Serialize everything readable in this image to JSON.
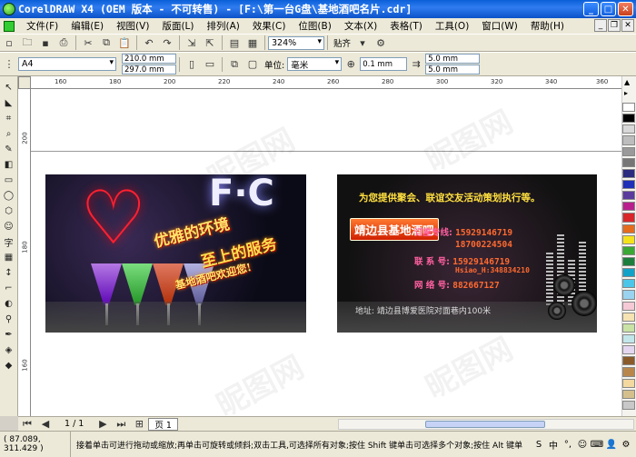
{
  "window": {
    "title": "CorelDRAW X4 (OEM 版本 - 不可转售) - [F:\\第一台G盘\\基地酒吧名片.cdr]"
  },
  "menu": [
    "文件(F)",
    "编辑(E)",
    "视图(V)",
    "版面(L)",
    "排列(A)",
    "效果(C)",
    "位图(B)",
    "文本(X)",
    "表格(T)",
    "工具(O)",
    "窗口(W)",
    "帮助(H)"
  ],
  "toolbar1": {
    "zoom": "324%",
    "snap": "贴齐"
  },
  "toolbar2": {
    "paper_size": "A4",
    "width": "210.0 mm",
    "height": "297.0 mm",
    "unit_label": "单位:",
    "unit": "毫米",
    "nudge": "0.1 mm",
    "dup_x": "5.0 mm",
    "dup_y": "5.0 mm"
  },
  "ruler": {
    "h_ticks": [
      "160",
      "180",
      "200",
      "220",
      "240",
      "260",
      "280",
      "300",
      "320",
      "340",
      "360"
    ],
    "v_ticks": [
      "200",
      "180",
      "160"
    ]
  },
  "card_left": {
    "logo": "F·C",
    "slogan1": "优雅的环境",
    "slogan2": "至上的服务",
    "slogan3": "基地酒吧欢迎您!"
  },
  "card_right": {
    "tagline": "为您提供聚会、联谊交友活动策划执行等。",
    "name": "靖边县基地酒吧",
    "contacts": [
      {
        "label": "订座专线:",
        "value": "15929146719"
      },
      {
        "label": "",
        "value": "18700224504"
      },
      {
        "label": "联 系 号:",
        "value": "15929146719"
      },
      {
        "label": "",
        "value": "Hsiao_H:348834210"
      },
      {
        "label": "网 络 号:",
        "value": "882667127"
      }
    ],
    "address": "地址: 靖边县博爱医院对面巷内100米"
  },
  "watermarks": [
    "昵图网",
    "昵图网",
    "昵图网",
    "昵图网"
  ],
  "nav": {
    "page_count": "1 / 1",
    "page_tab": "页 1"
  },
  "status": {
    "coords": "( 87.089, 311.429 )",
    "hint": "接着单击可进行拖动或缩放;再单击可旋转或倾斜;双击工具,可选择所有对象;按住 Shift 键单击可选择多个对象;按住 Alt 键单",
    "ime": [
      "S",
      "中",
      "°,",
      "☺",
      "⌨",
      "👤",
      "⚙"
    ]
  },
  "palette": [
    "#ffffff",
    "#000000",
    "#d8d8d8",
    "#bdbdbd",
    "#9a9a9a",
    "#767676",
    "#2b2b7f",
    "#1e2fb8",
    "#5b3a9e",
    "#b81f8d",
    "#d8262a",
    "#e56b1d",
    "#f4e21c",
    "#3aa835",
    "#1c7e3d",
    "#12a2c8",
    "#4cc6e8",
    "#9ad3f0",
    "#f6c9d6",
    "#f5e3b3",
    "#c9e2a6",
    "#c2e6ea",
    "#e4d6f0",
    "#8a5a2b",
    "#b8864b",
    "#f3d8a0",
    "#d5c08d",
    "#c8c8c8"
  ]
}
